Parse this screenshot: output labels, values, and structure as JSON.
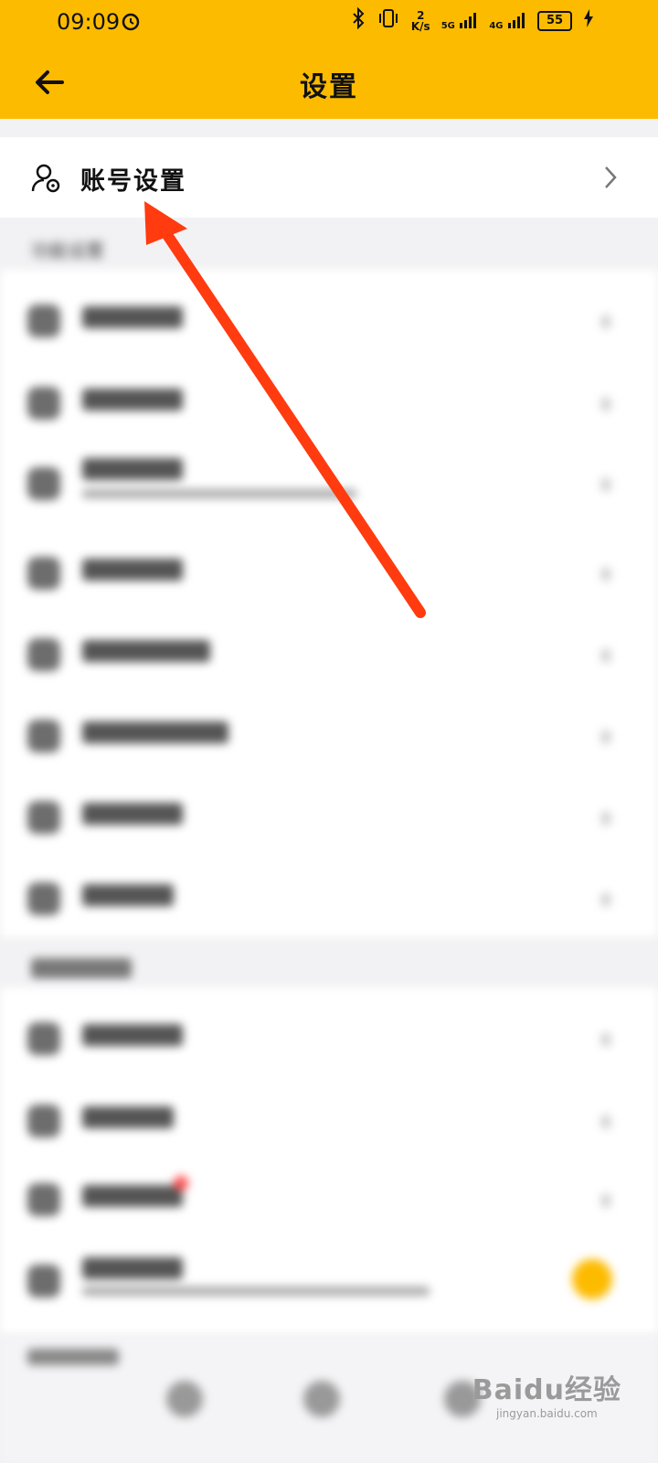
{
  "status_bar": {
    "time": "09:09",
    "speed_value": "2",
    "speed_unit": "K/s",
    "net1": "5G",
    "net2": "4G",
    "battery": "55"
  },
  "header": {
    "title": "设置"
  },
  "account_row": {
    "label": "账号设置"
  },
  "section1": {
    "label": "功能设置"
  },
  "watermark": {
    "brand": "Baidu经验",
    "url": "jingyan.baidu.com"
  },
  "colors": {
    "header_bg": "#fdbb00",
    "arrow": "#ff3b0f"
  }
}
